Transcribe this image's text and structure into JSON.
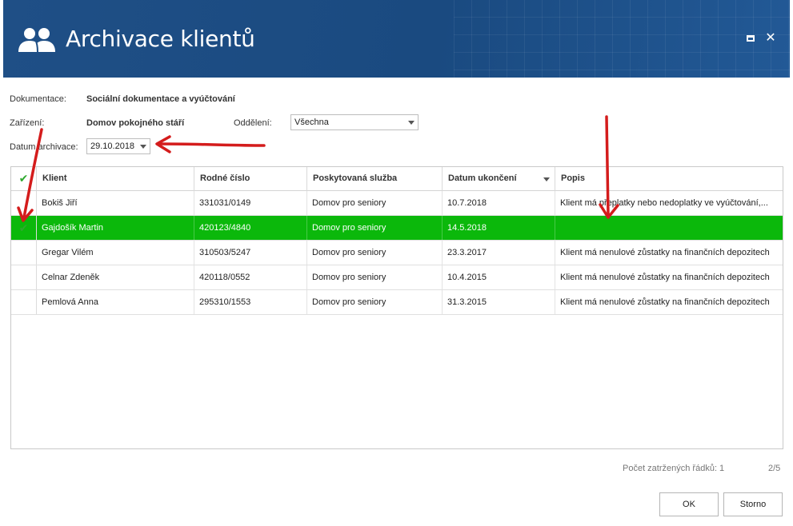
{
  "window": {
    "title": "Archivace klientů",
    "icon": "users-icon"
  },
  "form": {
    "dokumentace_label": "Dokumentace:",
    "dokumentace_value": "Sociální dokumentace a vyúčtování",
    "zarizeni_label": "Zařízení:",
    "zarizeni_value": "Domov pokojného stáří",
    "oddeleni_label": "Oddělení:",
    "oddeleni_value": "Všechna",
    "datum_label": "Datum archivace:",
    "datum_value": "29.10.2018"
  },
  "grid": {
    "columns": [
      "Klient",
      "Rodné číslo",
      "Poskytovaná služba",
      "Datum ukončení",
      "Popis"
    ],
    "rows": [
      {
        "checked": false,
        "selected": false,
        "klient": "Bokiš Jiří",
        "rodne_cislo": "331031/0149",
        "sluzba": "Domov pro seniory",
        "datum": "10.7.2018",
        "popis": "Klient má přeplatky nebo nedoplatky ve vyúčtování,..."
      },
      {
        "checked": true,
        "selected": true,
        "klient": "Gajdošík Martin",
        "rodne_cislo": "420123/4840",
        "sluzba": "Domov pro seniory",
        "datum": "14.5.2018",
        "popis": ""
      },
      {
        "checked": false,
        "selected": false,
        "klient": "Gregar Vilém",
        "rodne_cislo": "310503/5247",
        "sluzba": "Domov pro seniory",
        "datum": "23.3.2017",
        "popis": "Klient má nenulové zůstatky na finančních depozitech"
      },
      {
        "checked": false,
        "selected": false,
        "klient": "Celnar Zdeněk",
        "rodne_cislo": "420118/0552",
        "sluzba": "Domov pro seniory",
        "datum": "10.4.2015",
        "popis": "Klient má nenulové zůstatky na finančních depozitech"
      },
      {
        "checked": false,
        "selected": false,
        "klient": "Pemlová Anna",
        "rodne_cislo": "295310/1553",
        "sluzba": "Domov pro seniory",
        "datum": "31.3.2015",
        "popis": "Klient má nenulové zůstatky na finančních depozitech"
      }
    ]
  },
  "footer": {
    "checked_count": "Počet zatržených řádků: 1",
    "pager": "2/5"
  },
  "buttons": {
    "ok": "OK",
    "cancel": "Storno"
  },
  "colors": {
    "titlebar": "#1f4f86",
    "selected_row": "#0bb80b",
    "annotation_arrow": "#d41c1c",
    "check": "#2fa82f"
  }
}
